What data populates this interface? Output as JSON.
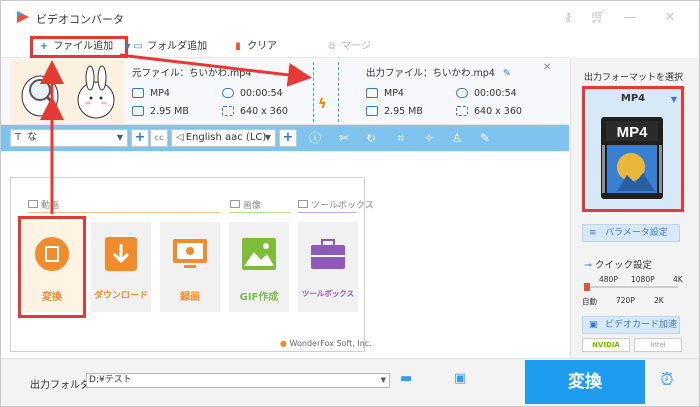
{
  "app": {
    "title": "ビデオコンバータ"
  },
  "toolbar": {
    "add_file": "ファイル追加",
    "add_folder": "フォルダ追加",
    "clear": "クリア",
    "merge": "マージ"
  },
  "file": {
    "source_label": "元ファイル：ちいかわ.mp4",
    "output_label": "出力ファイル：ちいかわ.mp4",
    "src_format": "MP4",
    "src_duration": "00:00:54",
    "src_size": "2.95 MB",
    "src_resolution": "640 x 360",
    "out_format": "MP4",
    "out_duration": "00:00:54",
    "out_size": "2.95 MB",
    "out_resolution": "640 x 360"
  },
  "strip": {
    "subtitle_value": "な",
    "audio_track": "English aac (LC)"
  },
  "sections": {
    "video": "動画",
    "image": "画像",
    "toolbox": "ツールボックス"
  },
  "tiles": [
    {
      "label": "変換",
      "color": "#f08c2c"
    },
    {
      "label": "ダウンロード",
      "color": "#f08c2c"
    },
    {
      "label": "録画",
      "color": "#f08c2c"
    },
    {
      "label": "GIF作成",
      "color": "#7cbd3a"
    },
    {
      "label": "ツールボックス",
      "color": "#8e5ab8"
    }
  ],
  "brand": "WonderFox Soft, Inc.",
  "right": {
    "select_title": "出力フォーマットを選択",
    "format": "MP4",
    "param_settings": "パラメータ設定",
    "quick_settings": "クイック設定",
    "q_top": [
      "480P",
      "1080P",
      "4K"
    ],
    "q_bottom": [
      "自動",
      "720P",
      "2K"
    ],
    "gpu_accel": "ビデオカード加速",
    "nvidia": "NVIDIA",
    "intel": "Intel"
  },
  "bottom": {
    "output_folder_label": "出力フォルダ：",
    "output_folder_value": "D:¥テスト",
    "convert": "変換"
  },
  "colors": {
    "accent": "#1e9cf0",
    "annotation": "#e53935",
    "strip": "#7fc3ef",
    "orange": "#f08c2c"
  }
}
